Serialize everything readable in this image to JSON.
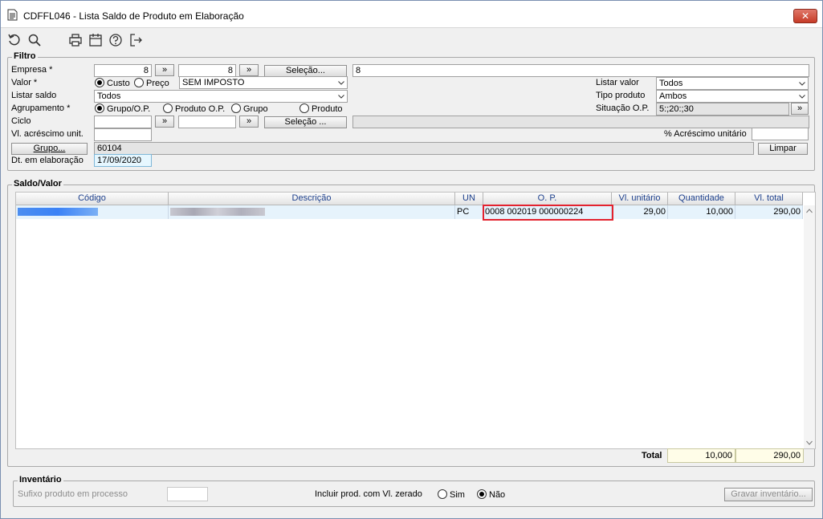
{
  "window": {
    "title": "CDFFL046 - Lista Saldo de Produto em Elaboração",
    "close": "✕"
  },
  "filtro": {
    "title": "Filtro",
    "empresa_label": "Empresa *",
    "empresa_from": "8",
    "empresa_to": "8",
    "selecao_label": "Seleção...",
    "selecao_value": "8",
    "valor_label": "Valor *",
    "custo_label": "Custo",
    "preco_label": "Preço",
    "valor_select": "SEM IMPOSTO",
    "listar_saldo_label": "Listar saldo",
    "listar_saldo_value": "Todos",
    "agrupamento_label": "Agrupamento *",
    "agr_grupo_op": "Grupo/O.P.",
    "agr_produto_op": "Produto O.P.",
    "agr_grupo": "Grupo",
    "agr_produto": "Produto",
    "ciclo_label": "Ciclo",
    "ciclo_selecao_label": "Seleção ...",
    "vl_acrescimo_label": "Vl. acréscimo unit.",
    "grupo_button": "Grupo...",
    "grupo_value": "60104",
    "dt_label": "Dt. em elaboração",
    "dt_value": "17/09/2020",
    "listar_valor_label": "Listar valor",
    "listar_valor_value": "Todos",
    "tipo_produto_label": "Tipo produto",
    "tipo_produto_value": "Ambos",
    "situacao_label": "Situação O.P.",
    "situacao_value": "5:;20:;30",
    "pct_acrescimo_label": "% Acréscimo unitário",
    "limpar_label": "Limpar",
    "arrow": "»"
  },
  "saldo": {
    "title": "Saldo/Valor",
    "headers": [
      "Código",
      "Descrição",
      "UN",
      "O. P.",
      "Vl. unitário",
      "Quantidade",
      "Vl. total"
    ],
    "row": {
      "un": "PC",
      "op": "0008  002019  000000224",
      "vl_unit": "29,00",
      "quantidade": "10,000",
      "vl_total": "290,00"
    },
    "total_label": "Total",
    "total_quantidade": "10,000",
    "total_valor": "290,00"
  },
  "inventario": {
    "title": "Inventário",
    "sufixo_label": "Sufixo produto em processo",
    "incluir_label": "Incluir prod. com Vl. zerado",
    "sim_label": "Sim",
    "nao_label": "Não",
    "gravar_label": "Gravar inventário..."
  },
  "colors": {
    "accent": "#1c3f8c",
    "highlight": "#e3232f",
    "row_bg": "#e6f3fc",
    "blur": "#3b82f6"
  }
}
